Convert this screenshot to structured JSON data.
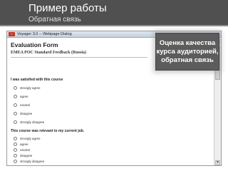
{
  "slide": {
    "title": "Пример работы",
    "subtitle": "Обратная связь"
  },
  "window": {
    "title": "Voyager 3.0 -- Webpage Dialog",
    "icon": "app-icon"
  },
  "form": {
    "title": "Evaluation Form",
    "subtitle": "EMEA POC Standard Feedback (Russia)",
    "questions": [
      {
        "text": "I was satisfied with this course",
        "options": [
          "strongly agree",
          "agree",
          "neutral",
          "disagree",
          "strongly disagree"
        ]
      },
      {
        "text": "This course was relevant to my current job.",
        "options": [
          "strongly agree",
          "agree",
          "neutral",
          "disagree",
          "strongly disagree"
        ]
      }
    ]
  },
  "callout": {
    "text": "Оценка качества курса аудиторией, обратная связь"
  }
}
